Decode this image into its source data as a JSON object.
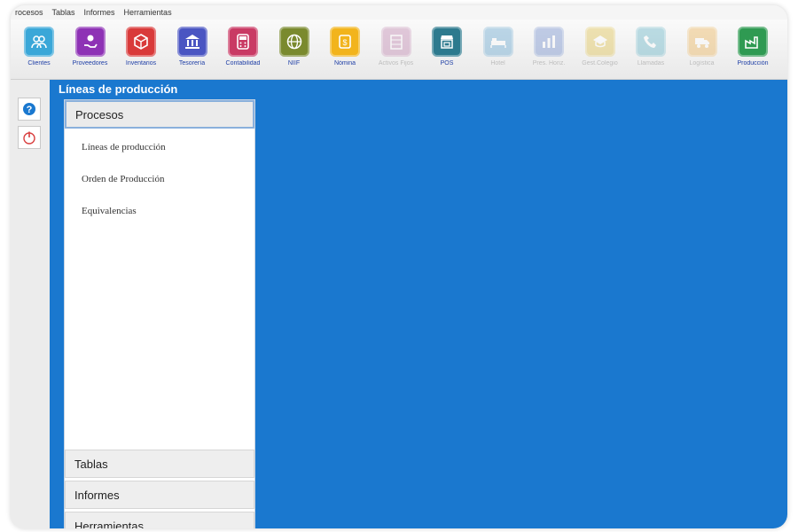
{
  "menubar": [
    "rocesos",
    "Tablas",
    "Informes",
    "Herramientas"
  ],
  "toolbar": [
    {
      "label": "Clientes",
      "icon": "users-icon",
      "color": "#3aa7d8",
      "disabled": false
    },
    {
      "label": "Proveedores",
      "icon": "hand-coin-icon",
      "color": "#8e32b5",
      "disabled": false
    },
    {
      "label": "Inventarios",
      "icon": "box-icon",
      "color": "#d93a3a",
      "disabled": false
    },
    {
      "label": "Tesorería",
      "icon": "bank-icon",
      "color": "#4a55c2",
      "disabled": false
    },
    {
      "label": "Contabilidad",
      "icon": "calculator-icon",
      "color": "#c93a64",
      "disabled": false
    },
    {
      "label": "NIIF",
      "icon": "globe-icon",
      "color": "#7a8a2e",
      "disabled": false
    },
    {
      "label": "Nómina",
      "icon": "payroll-icon",
      "color": "#f2b41c",
      "disabled": false
    },
    {
      "label": "Activos Fijos",
      "icon": "building-icon",
      "color": "#b0649a",
      "disabled": true
    },
    {
      "label": "POS",
      "icon": "store-icon",
      "color": "#2d7a8e",
      "disabled": false
    },
    {
      "label": "Hotel",
      "icon": "bed-icon",
      "color": "#3b8fc4",
      "disabled": true
    },
    {
      "label": "Pres. Horiz.",
      "icon": "chart-icon",
      "color": "#4b6fc0",
      "disabled": true
    },
    {
      "label": "Gest.Colegio",
      "icon": "school-icon",
      "color": "#d9b21c",
      "disabled": true
    },
    {
      "label": "Llamadas",
      "icon": "phone-icon",
      "color": "#3aa0b8",
      "disabled": true
    },
    {
      "label": "Logística",
      "icon": "truck-icon",
      "color": "#e8a02a",
      "disabled": true
    },
    {
      "label": "Producción",
      "icon": "factory-icon",
      "color": "#2f9a52",
      "disabled": false
    },
    {
      "label": "",
      "icon": "more-icon",
      "color": "#d94a7a",
      "disabled": true
    }
  ],
  "side_buttons": [
    {
      "icon": "help-icon",
      "color": "#1a78cf"
    },
    {
      "icon": "power-icon",
      "color": "#d94040"
    }
  ],
  "panel": {
    "title": "Líneas de producción",
    "sections": [
      {
        "label": "Procesos",
        "active": true,
        "items": [
          "Líneas de producción",
          "Orden de Producción",
          "Equivalencias"
        ]
      },
      {
        "label": "Tablas",
        "active": false,
        "items": []
      },
      {
        "label": "Informes",
        "active": false,
        "items": []
      },
      {
        "label": "Herramientas",
        "active": false,
        "items": []
      }
    ]
  }
}
